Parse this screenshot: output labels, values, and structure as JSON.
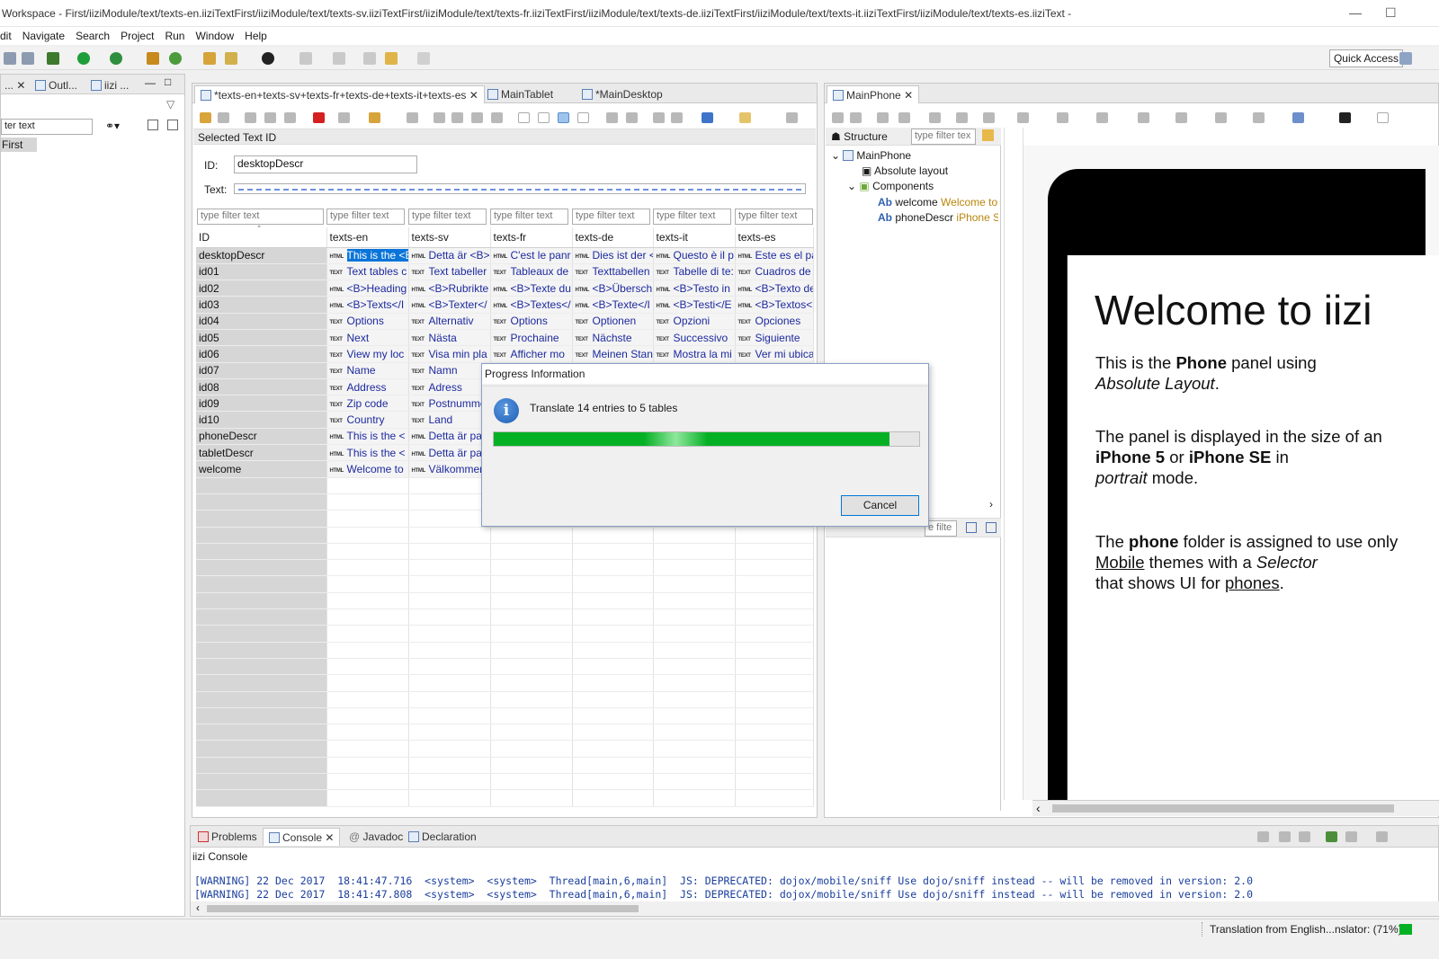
{
  "window": {
    "title": "Workspace - First/iiziModule/text/texts-en.iiziTextFirst/iiziModule/text/texts-sv.iiziTextFirst/iiziModule/text/texts-fr.iiziTextFirst/iiziModule/text/texts-de.iiziTextFirst/iiziModule/text/texts-it.iiziTextFirst/iiziModule/text/texts-es.iiziText -"
  },
  "menu": [
    "dit",
    "Navigate",
    "Search",
    "Project",
    "Run",
    "Window",
    "Help"
  ],
  "toolbar": {
    "quick_access": "Quick Access"
  },
  "left_panel": {
    "tabs": [
      "...",
      "Outl...",
      "iizi ..."
    ],
    "filter_value": "ter text",
    "tree_item": "First"
  },
  "editor": {
    "tabs": [
      "*texts-en+texts-sv+texts-fr+texts-de+texts-it+texts-es",
      "MainTablet",
      "*MainDesktop"
    ],
    "selected_text_id_label": "Selected Text ID",
    "id_label": "ID:",
    "id_value": "desktopDescr",
    "text_label": "Text:",
    "filter_placeholder": "type filter text",
    "columns": [
      "ID",
      "texts-en",
      "texts-sv",
      "texts-fr",
      "texts-de",
      "texts-it",
      "texts-es"
    ],
    "rows": [
      {
        "id": "desktopDescr",
        "t": "HTML",
        "cells": [
          "This is the <B",
          "Detta är <B>",
          "C'est le panr",
          "Dies ist der <",
          "Questo è il p",
          "Este es el pai"
        ]
      },
      {
        "id": "id01",
        "t": "TEXT",
        "cells": [
          "Text tables c",
          "Text tabeller",
          "Tableaux de",
          "Texttabellen",
          "Tabelle di te:",
          "Cuadros de t"
        ]
      },
      {
        "id": "id02",
        "t": "HTML",
        "cells": [
          "<B>Heading",
          "<B>Rubrikte",
          "<B>Texte du",
          "<B>Übersch",
          "<B>Testo in",
          "<B>Texto de"
        ]
      },
      {
        "id": "id03",
        "t": "HTML",
        "cells": [
          "<B>Texts</I",
          "<B>Texter</",
          "<B>Textes</",
          "<B>Texte</I",
          "<B>Testi</E",
          "<B>Textos<"
        ]
      },
      {
        "id": "id04",
        "t": "TEXT",
        "cells": [
          "Options",
          "Alternativ",
          "Options",
          "Optionen",
          "Opzioni",
          "Opciones"
        ]
      },
      {
        "id": "id05",
        "t": "TEXT",
        "cells": [
          "Next",
          "Nästa",
          "Prochaine",
          "Nächste",
          "Successivo",
          "Siguiente"
        ]
      },
      {
        "id": "id06",
        "t": "TEXT",
        "cells": [
          "View my loc",
          "Visa min pla",
          "Afficher mo",
          "Meinen Stan",
          "Mostra la mi",
          "Ver mi ubica"
        ]
      },
      {
        "id": "id07",
        "t": "TEXT",
        "cells": [
          "Name",
          "Namn",
          "",
          "",
          "",
          ""
        ]
      },
      {
        "id": "id08",
        "t": "TEXT",
        "cells": [
          "Address",
          "Adress",
          "",
          "",
          "",
          ""
        ]
      },
      {
        "id": "id09",
        "t": "TEXT",
        "cells": [
          "Zip code",
          "Postnumme",
          "",
          "",
          "",
          ""
        ]
      },
      {
        "id": "id10",
        "t": "TEXT",
        "cells": [
          "Country",
          "Land",
          "",
          "",
          "",
          ""
        ]
      },
      {
        "id": "phoneDescr",
        "t": "HTML",
        "cells": [
          "This is the <",
          "Detta är par",
          "",
          "",
          "",
          ""
        ]
      },
      {
        "id": "tabletDescr",
        "t": "HTML",
        "cells": [
          "This is the <",
          "Detta är par",
          "",
          "",
          "",
          ""
        ]
      },
      {
        "id": "welcome",
        "t": "HTML",
        "cells": [
          "Welcome to",
          "Välkommer",
          "",
          "",
          "",
          ""
        ]
      }
    ]
  },
  "dialog": {
    "title": "Progress Information",
    "message": "Translate 14 entries to 5 tables",
    "progress": 0.93,
    "cancel": "Cancel"
  },
  "right_editor": {
    "tab": "MainPhone",
    "structure_label": "Structure",
    "filter_placeholder": "type filter tex",
    "tree": {
      "root": "MainPhone",
      "layout": "Absolute layout",
      "components": "Components",
      "items": [
        {
          "prefix": "Ab",
          "name": "welcome",
          "hint": "Welcome to"
        },
        {
          "prefix": "Ab",
          "name": "phoneDescr",
          "hint": "iPhone SE"
        }
      ]
    },
    "lower_filter": "e filte"
  },
  "phone": {
    "heading": "Welcome to iizi",
    "p1": {
      "a": "This is the ",
      "b": "Phone",
      "c": " panel using",
      "d": "Absolute Layout",
      "e": "."
    },
    "p2": {
      "a": "The panel is displayed in the size of an ",
      "b": "iPhone 5",
      "c": " or ",
      "d": "iPhone SE",
      "e": " in",
      "f": "portrait",
      "g": " mode."
    },
    "p3": {
      "a": "The ",
      "b": "phone",
      "c": " folder is assigned to use only ",
      "d": "Mobile",
      "e": " themes with a ",
      "f": "Selector",
      "g": " that shows UI for ",
      "h": "phones",
      "i": "."
    }
  },
  "bottom": {
    "tabs": [
      "Problems",
      "Console",
      "Javadoc",
      "Declaration"
    ],
    "console_title": "iizi Console",
    "lines": [
      "[WARNING] 22 Dec 2017  18:41:47.716  <system>  <system>  Thread[main,6,main]  JS: DEPRECATED: dojox/mobile/sniff Use dojo/sniff instead -- will be removed in version: 2.0",
      "[WARNING] 22 Dec 2017  18:41:47.808  <system>  <system>  Thread[main,6,main]  JS: DEPRECATED: dojox/mobile/sniff Use dojo/sniff instead -- will be removed in version: 2.0"
    ]
  },
  "status": {
    "text": "Translation from English...nslator: (71%)"
  },
  "colors": {
    "accent": "#0a74d9",
    "progress": "#06b025",
    "value_text": "#1d2a9e"
  }
}
